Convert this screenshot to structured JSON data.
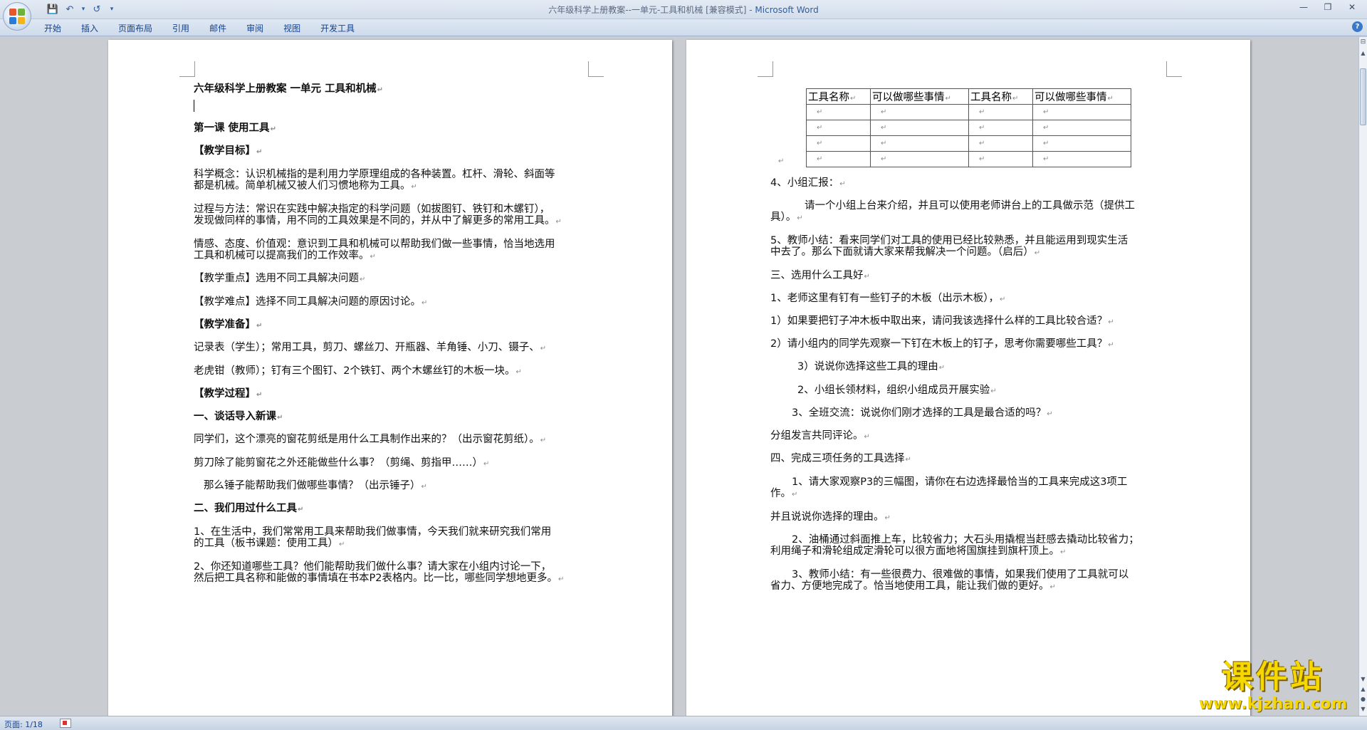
{
  "titlebar": {
    "document_title": "六年级科学上册教案--一单元-工具和机械 [兼容模式]",
    "separator": " - ",
    "app_name": "Microsoft Word",
    "qat": {
      "save": "💾",
      "undo": "↶",
      "dropdown": "▾",
      "redo": "↺",
      "customize": "▾"
    },
    "controls": {
      "minimize": "—",
      "restore": "❐",
      "close": "✕"
    }
  },
  "ribbon": {
    "tabs": [
      "开始",
      "插入",
      "页面布局",
      "引用",
      "邮件",
      "审阅",
      "视图",
      "开发工具"
    ],
    "help": "?"
  },
  "left_page": {
    "lines": [
      "六年级科学上册教案 一单元 工具和机械",
      "",
      "第一课 使用工具",
      "【教学目标】",
      "科学概念：认识机械指的是利用力学原理组成的各种装置。杠杆、滑轮、斜面等",
      "都是机械。简单机械又被人们习惯地称为工具。",
      "过程与方法：常识在实践中解决指定的科学问题（如拔图钉、铁钉和木螺钉），",
      "发现做同样的事情，用不同的工具效果是不同的，并从中了解更多的常用工具。",
      "情感、态度、价值观：意识到工具和机械可以帮助我们做一些事情，恰当地选用",
      "工具和机械可以提高我们的工作效率。",
      "【教学重点】选用不同工具解决问题",
      "【教学难点】选择不同工具解决问题的原因讨论。",
      "【教学准备】",
      "记录表（学生）；常用工具，剪刀、螺丝刀、开瓶器、羊角锤、小刀、镊子、",
      "老虎钳（教师）；钉有三个图钉、2个铁钉、两个木螺丝钉的木板一块。",
      "【教学过程】",
      "一、谈话导入新课",
      "同学们，这个漂亮的窗花剪纸是用什么工具制作出来的？（出示窗花剪纸）。",
      "剪刀除了能剪窗花之外还能做些什么事？（剪绳、剪指甲……）",
      "那么锤子能帮助我们做哪些事情？（出示锤子）",
      "二、我们用过什么工具",
      "1、在生活中，我们常常用工具来帮助我们做事情，今天我们就来研究我们常用",
      "的工具（板书课题：使用工具）",
      "2、你还知道哪些工具？他们能帮助我们做什么事？请大家在小组内讨论一下，",
      "然后把工具名称和能做的事情填在书本P2表格内。比一比，哪些同学想地更多。"
    ]
  },
  "right_page": {
    "table": {
      "headers": [
        "工具名称",
        "可以做哪些事情",
        "工具名称",
        "可以做哪些事情"
      ],
      "empty_rows": 4
    },
    "lines": [
      "",
      "4、小组汇报：",
      "请一个小组上台来介绍，并且可以使用老师讲台上的工具做示范（提供工",
      "具）。",
      "5、教师小结：看来同学们对工具的使用已经比较熟悉，并且能运用到现实生活",
      "中去了。那么下面就请大家来帮我解决一个问题。（启后）",
      "三、选用什么工具好",
      "1、老师这里有钉有一些钉子的木板（出示木板），",
      "1）如果要把钉子冲木板中取出来，请问我该选择什么样的工具比较合适？",
      "2）请小组内的同学先观察一下钉在木板上的钉子，思考你需要哪些工具？",
      "3）说说你选择这些工具的理由",
      "2、小组长领材料，组织小组成员开展实验",
      "3、全班交流：说说你们刚才选择的工具是最合适的吗？",
      "分组发言共同评论。",
      "四、完成三项任务的工具选择",
      "1、请大家观察P3的三幅图，请你在右边选择最恰当的工具来完成这3项工",
      "作。",
      "并且说说你选择的理由。",
      "2、油桶通过斜面推上车，比较省力；大石头用撬棍当赶感去撬动比较省力；",
      "利用绳子和滑轮组成定滑轮可以很方面地将国旗挂到旗杆顶上。",
      "3、教师小结：有一些很费力、很难做的事情，如果我们使用了工具就可以",
      "省力、方便地完成了。恰当地使用工具，能让我们做的更好。"
    ]
  },
  "paragraph_mark": "↵",
  "statusbar": {
    "page": "页面: 1/18"
  },
  "scrollbar": {
    "up": "▲",
    "down": "▼",
    "prev": "▲",
    "browse": "●",
    "next": "▼"
  },
  "watermark": {
    "title": "课件站",
    "url": "www.kjzhan.com"
  }
}
